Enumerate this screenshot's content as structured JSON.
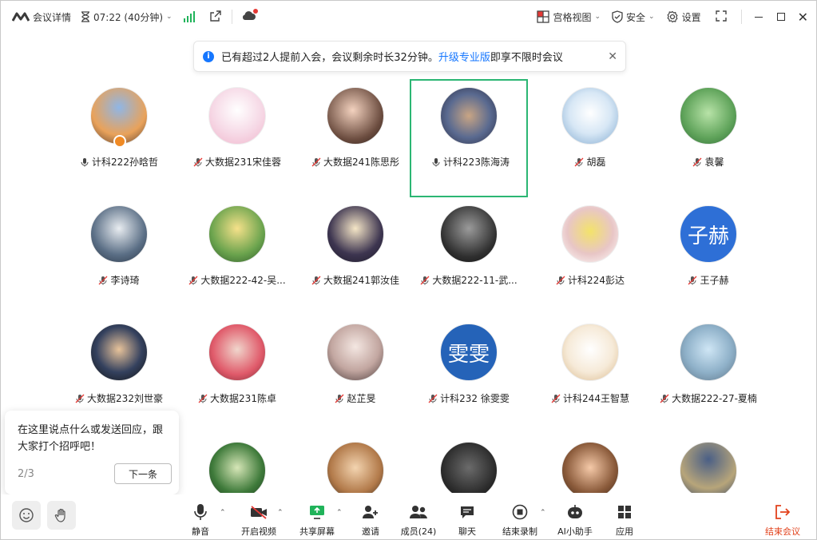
{
  "titlebar": {
    "meeting_info": "会议详情",
    "timer": "07:22 (40分钟)",
    "grid_view": "宫格视图",
    "security": "安全",
    "settings": "设置"
  },
  "banner": {
    "text_before": "已有超过2人提前入会，会议剩余时长32分钟。",
    "link": "升级专业版",
    "text_after": "即享不限时会议"
  },
  "participants": [
    {
      "name": "计科222孙晗哲",
      "muted": false
    },
    {
      "name": "大数据231宋佳蓉",
      "muted": true
    },
    {
      "name": "大数据241陈思彤",
      "muted": true
    },
    {
      "name": "计科223陈海涛",
      "muted": false,
      "active": true
    },
    {
      "name": "胡磊",
      "muted": true
    },
    {
      "name": "袁馨",
      "muted": true
    },
    {
      "name": "李诗琦",
      "muted": true
    },
    {
      "name": "大数据222-42-吴...",
      "muted": true
    },
    {
      "name": "大数据241郭汝佳",
      "muted": true
    },
    {
      "name": "大数据222-11-武...",
      "muted": true
    },
    {
      "name": "计科224彭达",
      "muted": true
    },
    {
      "name": "王子赫",
      "muted": true,
      "avatar_text": "子赫"
    },
    {
      "name": "大数据232刘世豪",
      "muted": true
    },
    {
      "name": "大数据231陈卓",
      "muted": true
    },
    {
      "name": "赵芷旻",
      "muted": true
    },
    {
      "name": "计科232 徐雯雯",
      "muted": true,
      "avatar_text": "雯雯"
    },
    {
      "name": "计科244王智慧",
      "muted": true
    },
    {
      "name": "大数据222-27-夏楠",
      "muted": true
    }
  ],
  "tip": {
    "message": "在这里说点什么或发送回应，跟大家打个招呼吧！",
    "page": "2/3",
    "next": "下一条"
  },
  "toolbar": {
    "mute": "静音",
    "video": "开启视频",
    "share": "共享屏幕",
    "invite": "邀请",
    "members": "成员(24)",
    "chat": "聊天",
    "recording": "结束录制",
    "ai": "AI小助手",
    "apps": "应用",
    "end": "结束会议"
  },
  "colors": {
    "accent": "#1677ff",
    "active_border": "#2bb673",
    "end": "#e2421c",
    "signal": "#20b35a"
  }
}
